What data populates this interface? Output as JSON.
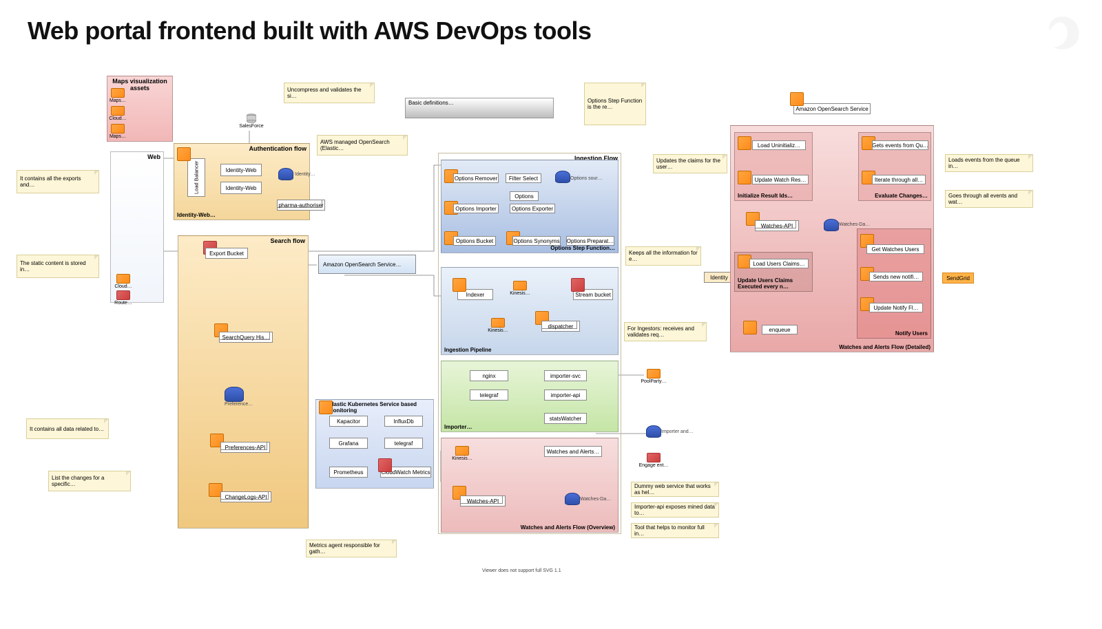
{
  "title": "Web portal frontend built with AWS DevOps tools",
  "footnote": "Viewer does not support full SVG 1.1",
  "groups": {
    "maps": {
      "label": "Maps visualization assets",
      "items": [
        "Maps…",
        "Cloud…",
        "Maps…"
      ]
    },
    "web": {
      "label": "Web"
    },
    "auth": {
      "label": "Authentication flow",
      "sub": "Identity-Web…"
    },
    "search": {
      "label": "Search flow"
    },
    "eks": {
      "label": "Elastic Kubernetes Service based Monitoring"
    },
    "ingest": {
      "label": "Ingestion Flow"
    },
    "ing_options": {
      "br": "Options Step Function…"
    },
    "ing_pipeline": {
      "bl": "Ingestion Pipeline"
    },
    "importer": {
      "bl": "Importer…"
    },
    "wa_overview": {
      "br": "Watches and Alerts Flow (Overview)"
    },
    "wa_detail": {
      "br": "Watches and Alerts Flow (Detailed)"
    },
    "init_result": {
      "bl": "Initialize Result Ids…"
    },
    "eval_changes": {
      "br": "Evaluate Changes…"
    },
    "update_users": {
      "bl": "Update Users Claims\nExecuted every n…"
    },
    "notify_users": {
      "br": "Notify Users"
    }
  },
  "nodes": {
    "salesforce": "SalesForce",
    "lb": "Load Balancer",
    "idweb1": "Identity-Web",
    "idweb2": "Identity-Web",
    "identity_db": "Identity…",
    "pharma": "pharma-authoriser",
    "cloud_icon": "Cloud…",
    "route_icon": "Route…",
    "export_bucket": "Export Bucket",
    "aos": "Amazon OpenSearch Service…",
    "sqh": "SearchQuery His…",
    "preference_db": "Preference…",
    "pref_api": "Preferences-API",
    "changelogs": "ChangeLogs-API",
    "kapacitor": "Kapacitor",
    "influx": "InfluxDb",
    "grafana": "Grafana",
    "telegraf_eks": "telegraf",
    "prometheus": "Prometheus",
    "cwmetrics": "CloudWatch Metrics",
    "basic_defs": "Basic definitions…",
    "opt_remover": "Options Remover",
    "filter_select": "Filter Select",
    "options_source": "Options sour…",
    "opt_importer": "Options Importer",
    "options": "Options",
    "opt_exporter": "Options Exporter",
    "opt_bucket": "Options Bucket",
    "opt_syn": "Options Synonyms",
    "opt_prep": "Options Preparat…",
    "indexer": "Indexer",
    "kinesis1": "Kinesis…",
    "stream_bucket": "Stream bucket",
    "kinesis2": "Kinesis…",
    "dispatcher": "dispatcher",
    "nginx": "nginx",
    "importer_svc": "importer-svc",
    "telegraf_imp": "telegraf",
    "importer_api": "importer-api",
    "stats_watcher": "statsWatcher",
    "poolparty": "PoolParty…",
    "importer_and": "Importer and…",
    "engage": "Engage ent…",
    "kinesis3": "Kinesis…",
    "watches_alerts": "Watches and Alerts…",
    "watches_api_ov": "Watches-API",
    "watches_db_ov": "Watches-Da…",
    "aos_top": "Amazon OpenSearch Service",
    "load_uninit": "Load Uninitializ…",
    "update_watch_res": "Update Watch Res…",
    "gets_events": "Gets events from Qu…",
    "iterate_all": "Iterate through all…",
    "watches_api_d": "Watches-API",
    "watches_db_d": "Watches-Da…",
    "load_claims": "Load Users Claims…",
    "enqueue": "enqueue",
    "get_watches_users": "Get Watches Users",
    "sends_notif": "Sends new notifi…",
    "update_notify": "Update Notify Fl…",
    "sendgrid": "SendGrid",
    "identity_right": "Identity"
  },
  "notes": {
    "exports": "It contains all the exports and…",
    "static_content": "The static content is stored in…",
    "data_related": "It contains all data related to…",
    "list_changes": "List the changes for a specific…",
    "uncompress": "Uncompress and validates the si…",
    "aws_managed": "AWS managed OpenSearch (Elastic…",
    "opt_step": "Options Step Function is the re…",
    "updates_claims": "Updates the claims for the user…",
    "keeps_info": "Keeps all the information for e…",
    "ingestors": "For Ingestors: receives and validates req…",
    "dummy_ws": "Dummy web service that works as hel…",
    "importer_api_note": "Importer-api exposes mined data to…",
    "monitor_full": "Tool that helps to monitor full in…",
    "metrics_agent": "Metrics agent responsible for gath…",
    "loads_queue": "Loads events from the queue in…",
    "goes_events": "Goes through all events and wat…"
  }
}
